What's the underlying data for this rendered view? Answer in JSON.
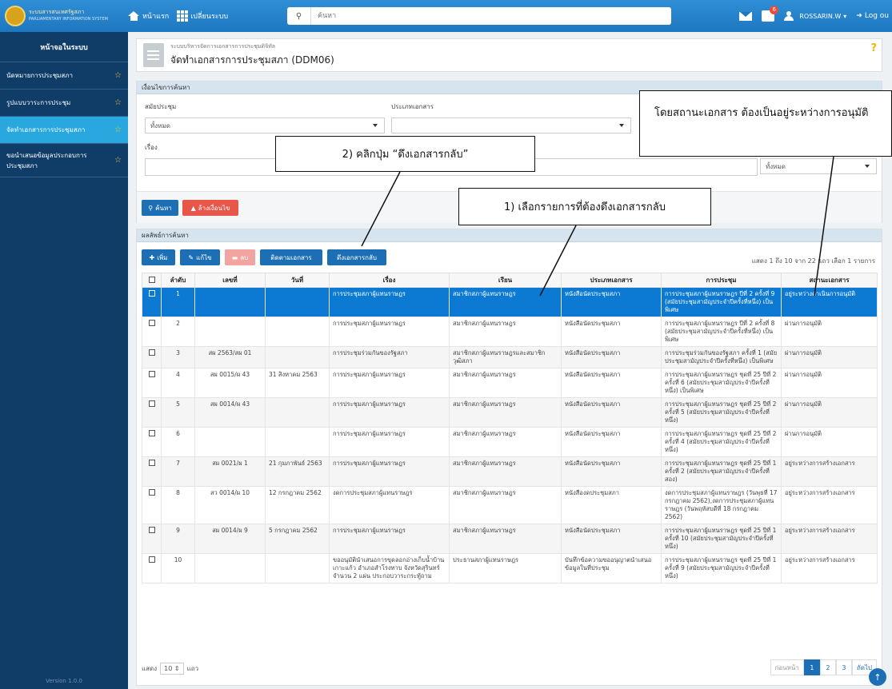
{
  "topbar": {
    "brand_line1": "ระบบสารสนเทศรัฐสภา",
    "brand_line2": "PARLIAMENTARY INFORMATION SYSTEM",
    "home_label": "หน้าแรก",
    "switch_label": "เปลี่ยนระบบ",
    "search_placeholder": "ค้นหา",
    "notif_count": "6",
    "user_name": "ROSSARIN.W",
    "logout_label": "Log ou"
  },
  "sidebar": {
    "header": "หน้าจอในระบบ",
    "items": [
      {
        "label": "นัดหมายการประชุมสภา"
      },
      {
        "label": "รูปแบบวาระการประชุม"
      },
      {
        "label": "จัดทำเอกสารการประชุมสภา"
      },
      {
        "label": "ขอนำเสนอข้อมูลประกอบการประชุมสภา"
      }
    ],
    "version": "Version 1.0.0"
  },
  "page": {
    "subtitle": "ระบบบริหารจัดการเอกสารการประชุมดิจิทัล",
    "title": "จัดทำเอกสารการประชุมสภา (DDM06)",
    "help": "?"
  },
  "filter": {
    "header": "เงื่อนไขการค้นหา",
    "meeting_type_label": "สมัยประชุม",
    "meeting_type_value": "ทั้งหมด",
    "doc_type_label": "ประเภทเอกสาร",
    "subject_label": "เรื่อง",
    "status_value": "ทั้งหมด",
    "search_btn": "ค้นหา",
    "clear_btn": "ล้างเงื่อนไข"
  },
  "results": {
    "header": "ผลลัพธ์การค้นหา",
    "add_btn": "เพิ่ม",
    "edit_btn": "แก้ไข",
    "delete_btn": "ลบ",
    "track_btn": "ติดตามเอกสาร",
    "recall_btn": "ดึงเอกสารกลับ",
    "showing": "แสดง 1 ถึง 10 จาก 22 แถว   เลือก 1 รายการ",
    "columns": [
      "ลำดับ",
      "เลขที่",
      "วันที่",
      "เรื่อง",
      "เรียน",
      "ประเภทเอกสาร",
      "การประชุม",
      "สถานะเอกสาร"
    ],
    "rows": [
      [
        "1",
        "",
        "",
        "การประชุมสภาผู้แทนราษฎร",
        "สมาชิกสภาผู้แทนราษฎร",
        "หนังสือนัดประชุมสภา",
        "การประชุมสภาผู้แทนราษฎร ปีที่ 2 ครั้งที่ 9 (สมัยประชุมสามัญประจำปีครั้งที่หนึ่ง) เป็นพิเศษ",
        "อยู่ระหว่างดำเนินการอนุมัติ"
      ],
      [
        "2",
        "",
        "",
        "การประชุมสภาผู้แทนราษฎร",
        "สมาชิกสภาผู้แทนราษฎร",
        "หนังสือนัดประชุมสภา",
        "การประชุมสภาผู้แทนราษฎร ปีที่ 2 ครั้งที่ 8 (สมัยประชุมสามัญประจำปีครั้งที่หนึ่ง) เป็นพิเศษ",
        "ผ่านการอนุมัติ"
      ],
      [
        "3",
        "สผ 2563/สผ 01",
        "",
        "การประชุมร่วมกันของรัฐสภา",
        "สมาชิกสภาผู้แทนราษฎรและสมาชิกวุฒิสภา",
        "หนังสือนัดประชุมสภา",
        "การประชุมร่วมกันของรัฐสภา ครั้งที่ 1 (สมัยประชุมสามัญประจำปีครั้งที่หนึ่ง) เป็นพิเศษ",
        "ผ่านการอนุมัติ"
      ],
      [
        "4",
        "สผ 0015/ผ 43",
        "31 สิงหาคม 2563",
        "การประชุมสภาผู้แทนราษฎร",
        "สมาชิกสภาผู้แทนราษฎร",
        "หนังสือนัดประชุมสภา",
        "การประชุมสภาผู้แทนราษฎร ชุดที่ 25 ปีที่ 2 ครั้งที่ 6 (สมัยประชุมสามัญประจำปีครั้งที่หนึ่ง) เป็นพิเศษ",
        "ผ่านการอนุมัติ"
      ],
      [
        "5",
        "สผ 0014/ผ 43",
        "",
        "การประชุมสภาผู้แทนราษฎร",
        "สมาชิกสภาผู้แทนราษฎร",
        "หนังสือนัดประชุมสภา",
        "การประชุมสภาผู้แทนราษฎร ชุดที่ 25 ปีที่ 2 ครั้งที่ 5 (สมัยประชุมสามัญประจำปีครั้งที่หนึ่ง)",
        "ผ่านการอนุมัติ"
      ],
      [
        "6",
        "",
        "",
        "การประชุมสภาผู้แทนราษฎร",
        "สมาชิกสภาผู้แทนราษฎร",
        "หนังสือนัดประชุมสภา",
        "การประชุมสภาผู้แทนราษฎร ชุดที่ 25 ปีที่ 2 ครั้งที่ 4 (สมัยประชุมสามัญประจำปีครั้งที่หนึ่ง)",
        "ผ่านการอนุมัติ"
      ],
      [
        "7",
        "สผ 0021/ผ 1",
        "21 กุมภาพันธ์ 2563",
        "การประชุมสภาผู้แทนราษฎร",
        "สมาชิกสภาผู้แทนราษฎร",
        "หนังสือนัดประชุมสภา",
        "การประชุมสภาผู้แทนราษฎร ชุดที่ 25 ปีที่ 1 ครั้งที่ 2 (สมัยประชุมสามัญประจำปีครั้งที่สอง)",
        "อยู่ระหว่างการสร้างเอกสาร"
      ],
      [
        "8",
        "สว 0014/ผ 10",
        "12 กรกฎาคม 2562",
        "งดการประชุมสภาผู้แทนราษฎร",
        "สมาชิกสภาผู้แทนราษฎร",
        "หนังสืองดประชุมสภา",
        "งดการประชุมสภาผู้แทนราษฎร (วันพุธที่ 17 กรกฎาคม 2562),งดการประชุมสภาผู้แทนราษฎร (วันพฤหัสบดีที่ 18 กรกฎาคม 2562)",
        "อยู่ระหว่างการสร้างเอกสาร"
      ],
      [
        "9",
        "สผ 0014/ผ 9",
        "5 กรกฎาคม 2562",
        "การประชุมสภาผู้แทนราษฎร",
        "สมาชิกสภาผู้แทนราษฎร",
        "หนังสือนัดประชุมสภา",
        "การประชุมสภาผู้แทนราษฎร ชุดที่ 25 ปีที่ 1 ครั้งที่ 10 (สมัยประชุมสามัญประจำปีครั้งที่หนึ่ง)",
        "อยู่ระหว่างการสร้างเอกสาร"
      ],
      [
        "10",
        "",
        "",
        "ขออนุมัตินำเสนอการขุดลอกอ่างเก็บน้ำบ้านเกาะแก้ว อำเภอสำโรงทาบ จังหวัดสุรินทร์ จำนวน 2 แผ่น ประกอบวาระกระทู้ถาม",
        "ประธานสภาผู้แทนราษฎร",
        "บันทึกข้อความขออนุญาตนำเสนอข้อมูลในที่ประชุม",
        "การประชุมสภาผู้แทนราษฎร ชุดที่ 25 ปีที่ 1 ครั้งที่ 9 (สมัยประชุมสามัญประจำปีครั้งที่หนึ่ง)",
        "อยู่ระหว่างการสร้างเอกสาร"
      ]
    ],
    "perpage_label": "แสดง",
    "perpage_value": "10",
    "perpage_suffix": "แถว",
    "pager_prev": "ก่อนหน้า",
    "pages": [
      "1",
      "2",
      "3"
    ],
    "pager_next": "ถัดไป"
  },
  "callouts": {
    "c1": "1) เลือกรายการที่ต้องดึงเอกสารกลับ",
    "c2": "2) คลิกปุ่ม “ดึงเอกสารกลับ”",
    "c3": "โดยสถานะเอกสาร ต้องเป็นอยู่ระหว่างการอนุมัติ"
  },
  "colors": {
    "primary": "#1d6fb5",
    "selected_row": "#0c7ad3",
    "sidebar": "#0f3d68",
    "active_item": "#29a8e0"
  }
}
